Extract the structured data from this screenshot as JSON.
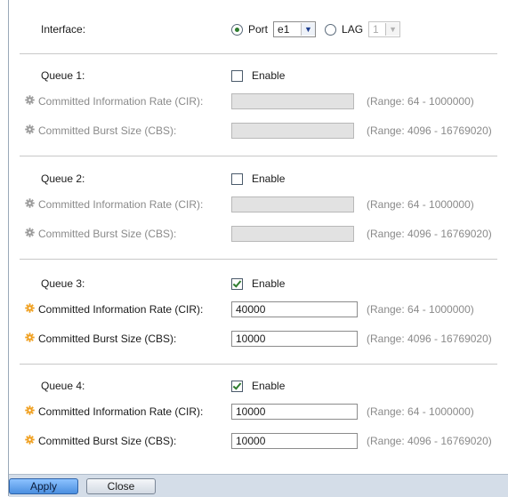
{
  "interface": {
    "label": "Interface:",
    "port_label": "Port",
    "port_value": "e1",
    "lag_label": "LAG",
    "lag_value": "1",
    "selected": "port"
  },
  "enable_label": "Enable",
  "queues": [
    {
      "label": "Queue 1:",
      "enabled": false,
      "cir_label": "Committed Information Rate (CIR):",
      "cir_value": "",
      "cir_range": "(Range: 64 - 1000000)",
      "cbs_label": "Committed Burst Size (CBS):",
      "cbs_value": "",
      "cbs_range": "(Range: 4096 - 16769020)"
    },
    {
      "label": "Queue 2:",
      "enabled": false,
      "cir_label": "Committed Information Rate (CIR):",
      "cir_value": "",
      "cir_range": "(Range: 64 - 1000000)",
      "cbs_label": "Committed Burst Size (CBS):",
      "cbs_value": "",
      "cbs_range": "(Range: 4096 - 16769020)"
    },
    {
      "label": "Queue 3:",
      "enabled": true,
      "cir_label": "Committed Information Rate (CIR):",
      "cir_value": "40000",
      "cir_range": "(Range: 64 - 1000000)",
      "cbs_label": "Committed Burst Size (CBS):",
      "cbs_value": "10000",
      "cbs_range": "(Range: 4096 - 16769020)"
    },
    {
      "label": "Queue 4:",
      "enabled": true,
      "cir_label": "Committed Information Rate (CIR):",
      "cir_value": "10000",
      "cir_range": "(Range: 64 - 1000000)",
      "cbs_label": "Committed Burst Size (CBS):",
      "cbs_value": "10000",
      "cbs_range": "(Range: 4096 - 16769020)"
    }
  ],
  "buttons": {
    "apply": "Apply",
    "close": "Close"
  },
  "colors": {
    "required_gear": "#f0a020",
    "disabled_gear": "#9a9a9a",
    "footer": "#d4dde8"
  },
  "icons": {
    "field_marker": "gear-icon"
  }
}
